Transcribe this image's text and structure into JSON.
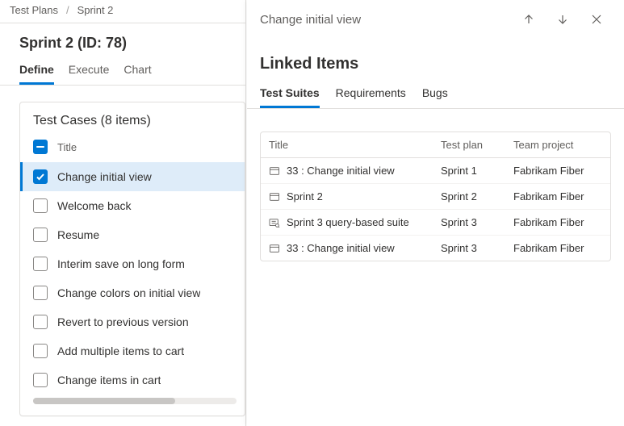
{
  "breadcrumb": {
    "root": "Test Plans",
    "current": "Sprint 2"
  },
  "page_title": "Sprint 2 (ID: 78)",
  "main_tabs": {
    "define": "Define",
    "execute": "Execute",
    "chart": "Chart"
  },
  "card_title": "Test Cases (8 items)",
  "list_header": "Title",
  "items": [
    {
      "title": "Change initial view",
      "checked": true
    },
    {
      "title": "Welcome back",
      "checked": false
    },
    {
      "title": "Resume",
      "checked": false
    },
    {
      "title": "Interim save on long form",
      "checked": false
    },
    {
      "title": "Change colors on initial view",
      "checked": false
    },
    {
      "title": "Revert to previous version",
      "checked": false
    },
    {
      "title": "Add multiple items to cart",
      "checked": false
    },
    {
      "title": "Change items in cart",
      "checked": false
    }
  ],
  "panel": {
    "title": "Change initial view",
    "section": "Linked Items",
    "tabs": {
      "suites": "Test Suites",
      "reqs": "Requirements",
      "bugs": "Bugs"
    },
    "columns": {
      "title": "Title",
      "plan": "Test plan",
      "project": "Team project"
    },
    "rows": [
      {
        "icon": "static",
        "title": "33 : Change initial view",
        "plan": "Sprint 1",
        "project": "Fabrikam Fiber"
      },
      {
        "icon": "static",
        "title": "Sprint 2",
        "plan": "Sprint 2",
        "project": "Fabrikam Fiber"
      },
      {
        "icon": "query",
        "title": "Sprint 3 query-based suite",
        "plan": "Sprint 3",
        "project": "Fabrikam Fiber"
      },
      {
        "icon": "static",
        "title": "33 : Change initial view",
        "plan": "Sprint 3",
        "project": "Fabrikam Fiber"
      }
    ]
  }
}
